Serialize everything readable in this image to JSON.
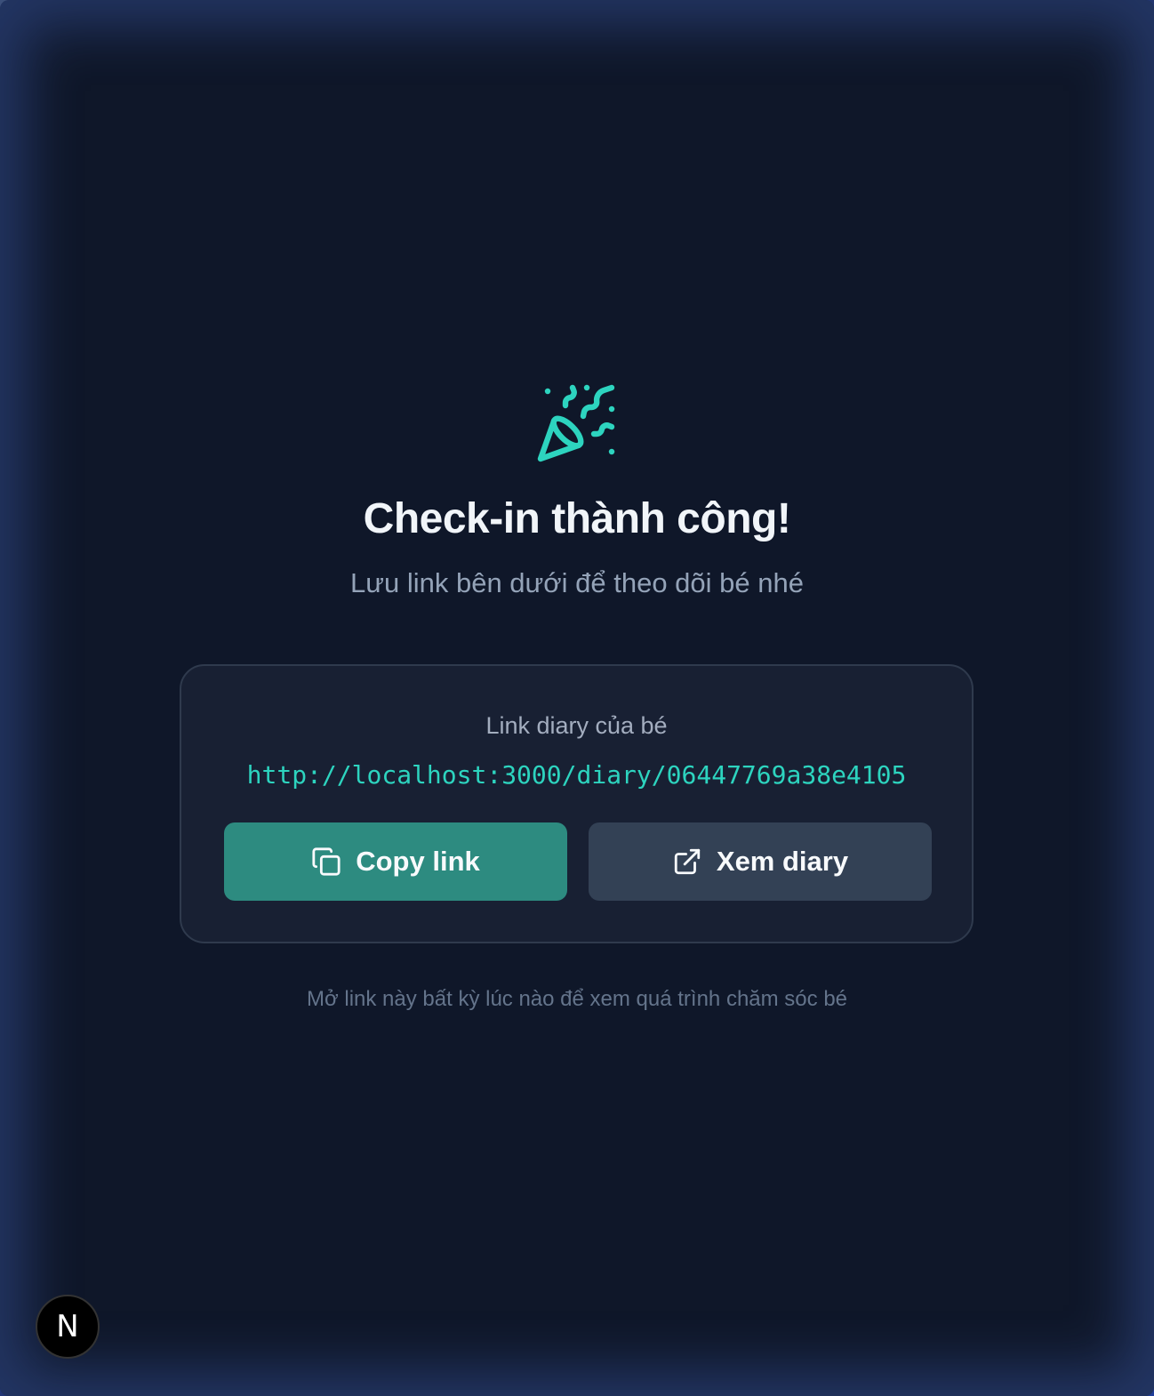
{
  "hero": {
    "icon": "party-popper-icon",
    "title": "Check-in thành công!",
    "subtitle": "Lưu link bên dưới để theo dõi bé nhé"
  },
  "card": {
    "label": "Link diary của bé",
    "link": "http://localhost:3000/diary/06447769a38e4105",
    "copy_button": {
      "label": "Copy link",
      "icon": "copy-icon"
    },
    "view_button": {
      "label": "Xem diary",
      "icon": "external-link-icon"
    }
  },
  "footer": {
    "note": "Mở link này bất kỳ lúc nào để xem quá trình chăm sóc bé"
  },
  "dev_badge": {
    "letter": "N",
    "icon": "nextjs-logo-icon"
  },
  "colors": {
    "accent": "#2dd4bf",
    "primary_button": "#2d8b80",
    "secondary_button": "#334155",
    "background": "#0f1729",
    "card": "#182033"
  }
}
